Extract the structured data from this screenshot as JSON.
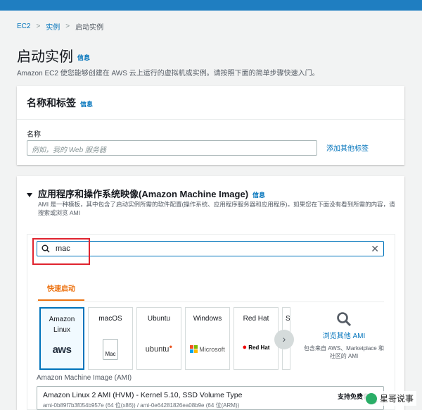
{
  "breadcrumb": {
    "root": "EC2",
    "level2": "实例",
    "current": "启动实例"
  },
  "page": {
    "title": "启动实例",
    "info": "信息",
    "subtitle": "Amazon EC2 使您能够创建在 AWS 云上运行的虚拟机或实例。请按照下面的简单步骤快速入门。"
  },
  "name_tags": {
    "title": "名称和标签",
    "info": "信息",
    "name_label": "名称",
    "name_placeholder": "例如，我的 Web 服务器",
    "add_tags": "添加其他标签"
  },
  "ami": {
    "title": "应用程序和操作系统映像(Amazon Machine Image)",
    "info": "信息",
    "desc": "AMI 是一种模板，其中包含了启动实例所需的软件配置(操作系统、应用程序服务器和应用程序)。如果您在下面没有看到所需的内容，请搜索或浏览 AMI",
    "search_value": "mac",
    "tab_quick_start": "快速启动",
    "tiles": [
      {
        "name": "Amazon Linux",
        "logo": "aws"
      },
      {
        "name": "macOS",
        "logo": "Mac"
      },
      {
        "name": "Ubuntu",
        "logo": "ubuntu"
      },
      {
        "name": "Windows",
        "logo": "Microsoft"
      },
      {
        "name": "Red Hat",
        "logo": "Red Hat"
      },
      {
        "name": "S",
        "logo": ""
      }
    ],
    "browse_link": "浏览其他 AMI",
    "browse_desc": "包含来自 AWS、Marketplace 和社区的 AMI",
    "select_label": "Amazon Machine Image (AMI)",
    "selected_title": "Amazon Linux 2 AMI (HVM) - Kernel 5.10, SSD Volume Type",
    "selected_sub": "ami-0b89f7b3f054b957e (64 位(x86)) / ami-0e64281826ea08b9e (64 位(ARM))",
    "selected_badge": "支持免费套"
  },
  "watermark": "星哥说事",
  "colors": {
    "link": "#0073bb",
    "accent": "#ec7211",
    "highlight": "#e0242f",
    "topbar": "#1f7ec1"
  }
}
